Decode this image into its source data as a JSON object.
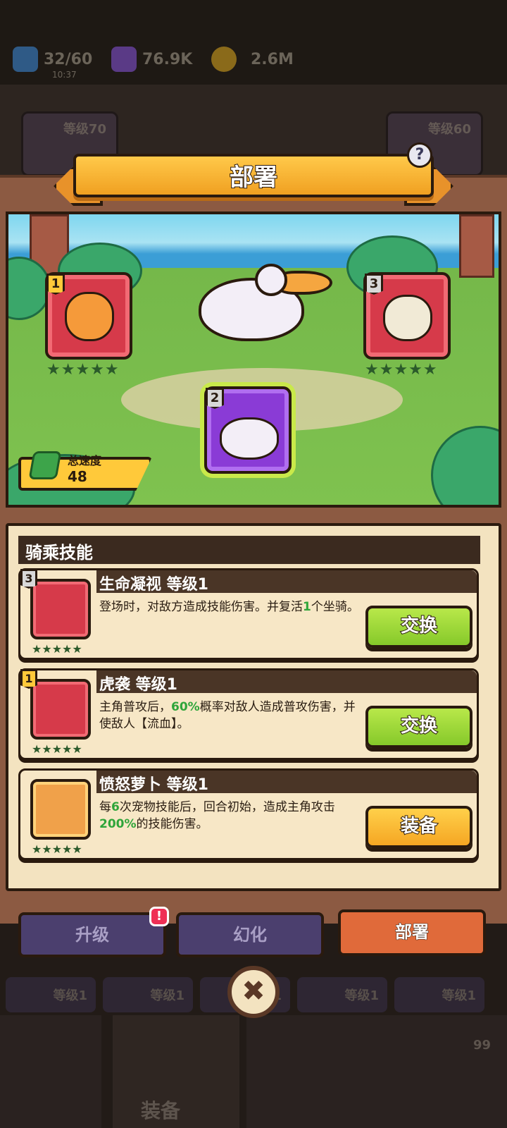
{
  "status": {
    "energy": "32/60",
    "energy_timer": "10:37",
    "gems": "76.9K",
    "coins": "2.6M"
  },
  "background": {
    "card_left_level": "等级70",
    "card_right_level": "等级60",
    "row_level": "等级1",
    "nav_label": "装备",
    "nav_badge_count": "99"
  },
  "dialog": {
    "title": "部署",
    "help_symbol": "?"
  },
  "formation": {
    "slots": [
      {
        "number": "1",
        "stars": "★★★★★"
      },
      {
        "number": "2",
        "stars": ""
      },
      {
        "number": "3",
        "stars": "★★★★★"
      }
    ],
    "speed_label": "总速度",
    "speed_value": "48"
  },
  "skills": {
    "section_title": "骑乘技能",
    "items": [
      {
        "slot": "3",
        "name": "生命凝视 等级1",
        "desc_parts": [
          "登场时，对敌方造成技能伤害。并复活",
          "1",
          "个坐骑。"
        ],
        "stars": "★★★★★",
        "button": "交换"
      },
      {
        "slot": "1",
        "name": "虎袭 等级1",
        "desc_parts": [
          "主角普攻后，",
          "60%",
          "概率对敌人造成普攻伤害，并使敌人【流血】。"
        ],
        "stars": "★★★★★",
        "button": "交换"
      },
      {
        "slot": "",
        "name": "愤怒萝卜 等级1",
        "desc_parts": [
          "每",
          "6",
          "次宠物技能后，回合初始，造成主角攻击",
          "200%",
          "的技能伤害。"
        ],
        "stars": "★★★★★",
        "button": "装备"
      }
    ]
  },
  "tabs": {
    "upgrade": "升级",
    "transform": "幻化",
    "deploy": "部署",
    "upgrade_badge": "!"
  },
  "close_symbol": "✖",
  "colors": {
    "accent_green": "#86c92a",
    "accent_yellow": "#f5a623",
    "active_tab": "#e06a3a",
    "highlight_text": "#2fa53a"
  }
}
